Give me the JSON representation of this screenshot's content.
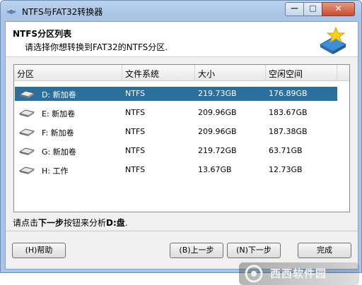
{
  "window": {
    "title": "NTFS与FAT32转换器"
  },
  "header": {
    "title": "NTFS分区列表",
    "subtitle": "请选择你想转换到FAT32的NTFS分区."
  },
  "list": {
    "columns": [
      "分区",
      "文件系统",
      "大小",
      "空闲空间"
    ],
    "rows": [
      {
        "partition": "D: 新加卷",
        "fs": "NTFS",
        "size": "219.73GB",
        "free": "176.89GB",
        "selected": true
      },
      {
        "partition": "E: 新加卷",
        "fs": "NTFS",
        "size": "209.96GB",
        "free": "183.67GB"
      },
      {
        "partition": "F: 新加卷",
        "fs": "NTFS",
        "size": "209.96GB",
        "free": "187.38GB"
      },
      {
        "partition": "G: 新加卷",
        "fs": "NTFS",
        "size": "219.72GB",
        "free": "63.71GB"
      },
      {
        "partition": "H: 工作",
        "fs": "NTFS",
        "size": "13.67GB",
        "free": "12.73GB"
      }
    ]
  },
  "status": {
    "prefix": "请点击",
    "next_bold": "下一步",
    "middle": "按钮来分析",
    "drive_bold": "D:盘",
    "suffix": "."
  },
  "buttons": {
    "help": "(H)帮助",
    "back": "(B)上一步",
    "next": "(N)下一步",
    "finish": "完成"
  },
  "watermark": {
    "text": "西西软件园"
  },
  "colors": {
    "selection": "#2a6f9d",
    "titlebar": "#bcd3ee"
  }
}
